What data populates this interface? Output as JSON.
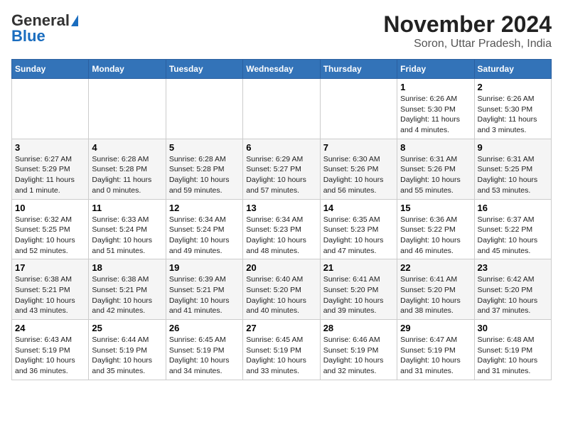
{
  "logo": {
    "line1": "General",
    "line2": "Blue"
  },
  "title": "November 2024",
  "subtitle": "Soron, Uttar Pradesh, India",
  "days_of_week": [
    "Sunday",
    "Monday",
    "Tuesday",
    "Wednesday",
    "Thursday",
    "Friday",
    "Saturday"
  ],
  "weeks": [
    [
      {
        "day": "",
        "info": ""
      },
      {
        "day": "",
        "info": ""
      },
      {
        "day": "",
        "info": ""
      },
      {
        "day": "",
        "info": ""
      },
      {
        "day": "",
        "info": ""
      },
      {
        "day": "1",
        "info": "Sunrise: 6:26 AM\nSunset: 5:30 PM\nDaylight: 11 hours and 4 minutes."
      },
      {
        "day": "2",
        "info": "Sunrise: 6:26 AM\nSunset: 5:30 PM\nDaylight: 11 hours and 3 minutes."
      }
    ],
    [
      {
        "day": "3",
        "info": "Sunrise: 6:27 AM\nSunset: 5:29 PM\nDaylight: 11 hours and 1 minute."
      },
      {
        "day": "4",
        "info": "Sunrise: 6:28 AM\nSunset: 5:28 PM\nDaylight: 11 hours and 0 minutes."
      },
      {
        "day": "5",
        "info": "Sunrise: 6:28 AM\nSunset: 5:28 PM\nDaylight: 10 hours and 59 minutes."
      },
      {
        "day": "6",
        "info": "Sunrise: 6:29 AM\nSunset: 5:27 PM\nDaylight: 10 hours and 57 minutes."
      },
      {
        "day": "7",
        "info": "Sunrise: 6:30 AM\nSunset: 5:26 PM\nDaylight: 10 hours and 56 minutes."
      },
      {
        "day": "8",
        "info": "Sunrise: 6:31 AM\nSunset: 5:26 PM\nDaylight: 10 hours and 55 minutes."
      },
      {
        "day": "9",
        "info": "Sunrise: 6:31 AM\nSunset: 5:25 PM\nDaylight: 10 hours and 53 minutes."
      }
    ],
    [
      {
        "day": "10",
        "info": "Sunrise: 6:32 AM\nSunset: 5:25 PM\nDaylight: 10 hours and 52 minutes."
      },
      {
        "day": "11",
        "info": "Sunrise: 6:33 AM\nSunset: 5:24 PM\nDaylight: 10 hours and 51 minutes."
      },
      {
        "day": "12",
        "info": "Sunrise: 6:34 AM\nSunset: 5:24 PM\nDaylight: 10 hours and 49 minutes."
      },
      {
        "day": "13",
        "info": "Sunrise: 6:34 AM\nSunset: 5:23 PM\nDaylight: 10 hours and 48 minutes."
      },
      {
        "day": "14",
        "info": "Sunrise: 6:35 AM\nSunset: 5:23 PM\nDaylight: 10 hours and 47 minutes."
      },
      {
        "day": "15",
        "info": "Sunrise: 6:36 AM\nSunset: 5:22 PM\nDaylight: 10 hours and 46 minutes."
      },
      {
        "day": "16",
        "info": "Sunrise: 6:37 AM\nSunset: 5:22 PM\nDaylight: 10 hours and 45 minutes."
      }
    ],
    [
      {
        "day": "17",
        "info": "Sunrise: 6:38 AM\nSunset: 5:21 PM\nDaylight: 10 hours and 43 minutes."
      },
      {
        "day": "18",
        "info": "Sunrise: 6:38 AM\nSunset: 5:21 PM\nDaylight: 10 hours and 42 minutes."
      },
      {
        "day": "19",
        "info": "Sunrise: 6:39 AM\nSunset: 5:21 PM\nDaylight: 10 hours and 41 minutes."
      },
      {
        "day": "20",
        "info": "Sunrise: 6:40 AM\nSunset: 5:20 PM\nDaylight: 10 hours and 40 minutes."
      },
      {
        "day": "21",
        "info": "Sunrise: 6:41 AM\nSunset: 5:20 PM\nDaylight: 10 hours and 39 minutes."
      },
      {
        "day": "22",
        "info": "Sunrise: 6:41 AM\nSunset: 5:20 PM\nDaylight: 10 hours and 38 minutes."
      },
      {
        "day": "23",
        "info": "Sunrise: 6:42 AM\nSunset: 5:20 PM\nDaylight: 10 hours and 37 minutes."
      }
    ],
    [
      {
        "day": "24",
        "info": "Sunrise: 6:43 AM\nSunset: 5:19 PM\nDaylight: 10 hours and 36 minutes."
      },
      {
        "day": "25",
        "info": "Sunrise: 6:44 AM\nSunset: 5:19 PM\nDaylight: 10 hours and 35 minutes."
      },
      {
        "day": "26",
        "info": "Sunrise: 6:45 AM\nSunset: 5:19 PM\nDaylight: 10 hours and 34 minutes."
      },
      {
        "day": "27",
        "info": "Sunrise: 6:45 AM\nSunset: 5:19 PM\nDaylight: 10 hours and 33 minutes."
      },
      {
        "day": "28",
        "info": "Sunrise: 6:46 AM\nSunset: 5:19 PM\nDaylight: 10 hours and 32 minutes."
      },
      {
        "day": "29",
        "info": "Sunrise: 6:47 AM\nSunset: 5:19 PM\nDaylight: 10 hours and 31 minutes."
      },
      {
        "day": "30",
        "info": "Sunrise: 6:48 AM\nSunset: 5:19 PM\nDaylight: 10 hours and 31 minutes."
      }
    ]
  ]
}
